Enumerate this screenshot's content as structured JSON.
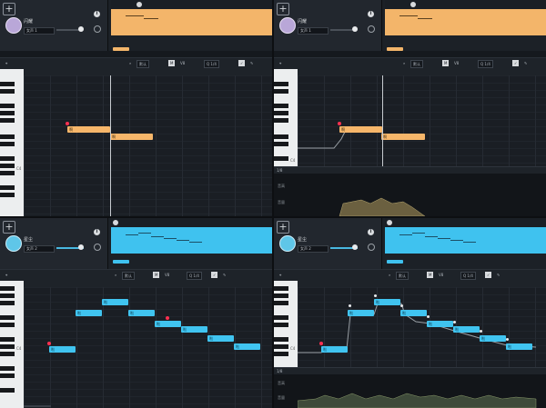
{
  "panels": [
    {
      "id": "p1",
      "color": "orange",
      "track": {
        "name": "闪耀",
        "voice": "女声 1"
      },
      "toolbar": {
        "mode": "默认",
        "tool_a": "M",
        "tool_b": "V8",
        "zoom": "Q 1/4",
        "snap": "1/4"
      },
      "key_label": "C4",
      "notes": [
        {
          "lyric": "啊"
        },
        {
          "lyric": "啊"
        }
      ]
    },
    {
      "id": "p2",
      "color": "orange",
      "track": {
        "name": "闪耀",
        "voice": "女声 1"
      },
      "toolbar": {
        "mode": "默认",
        "tool_a": "M",
        "tool_b": "V8",
        "zoom": "Q 1/4",
        "snap": "1/4"
      },
      "key_label": "C4",
      "notes": [
        {
          "lyric": "啊"
        },
        {
          "lyric": "啊"
        }
      ],
      "param": {
        "bar": "1/8",
        "label_top": "音高",
        "label_bottom": "音量"
      }
    },
    {
      "id": "p3",
      "color": "blue",
      "track": {
        "name": "星尘",
        "voice": "女声 2"
      },
      "toolbar": {
        "mode": "默认",
        "tool_a": "M",
        "tool_b": "V8",
        "zoom": "Q 1/4",
        "snap": "1/4"
      },
      "key_label": "C4",
      "notes": [
        {
          "lyric": "啦"
        },
        {
          "lyric": "啦"
        },
        {
          "lyric": "啦"
        },
        {
          "lyric": "啦"
        },
        {
          "lyric": "啦"
        },
        {
          "lyric": "啦"
        },
        {
          "lyric": "啦"
        },
        {
          "lyric": "啦"
        }
      ]
    },
    {
      "id": "p4",
      "color": "blue",
      "track": {
        "name": "星尘",
        "voice": "女声 2"
      },
      "toolbar": {
        "mode": "默认",
        "tool_a": "M",
        "tool_b": "V8",
        "zoom": "Q 1/4",
        "snap": "1/4"
      },
      "key_label": "C4",
      "notes": [
        {
          "lyric": "啦"
        },
        {
          "lyric": "啦"
        },
        {
          "lyric": "啦"
        },
        {
          "lyric": "啦"
        },
        {
          "lyric": "啦"
        },
        {
          "lyric": "啦"
        },
        {
          "lyric": "啦"
        },
        {
          "lyric": "啦"
        }
      ],
      "param": {
        "bar": "1/8",
        "label_top": "音高",
        "label_bottom": "音量"
      }
    }
  ],
  "colors": {
    "orange": "#f6b66a",
    "blue": "#40c4f0",
    "note_start": "#ff3050"
  },
  "icons": {
    "add": "+",
    "menu": "i"
  }
}
